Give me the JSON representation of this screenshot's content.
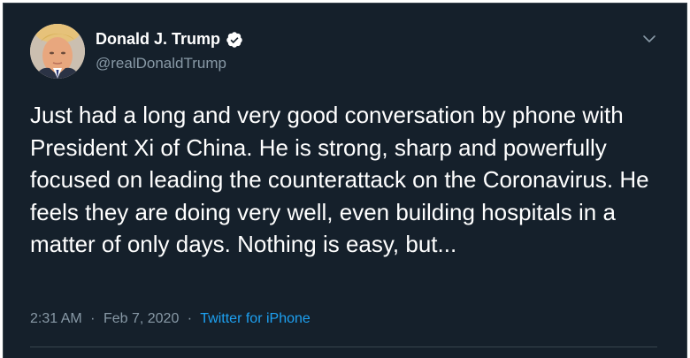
{
  "tweet": {
    "author": {
      "display_name": "Donald J. Trump",
      "handle": "@realDonaldTrump",
      "verified": true
    },
    "text": "Just had a long and very good conversation by phone with President Xi of China. He is strong, sharp and powerfully focused on leading the counterattack on the Coronavirus. He feels they are doing very well, even building hospitals in a matter of only days. Nothing is easy, but...",
    "time": "2:31 AM",
    "date": "Feb 7, 2020",
    "separator": "·",
    "source": "Twitter for iPhone"
  },
  "icons": {
    "verified": "verified-badge-icon",
    "more": "chevron-down-icon"
  },
  "colors": {
    "background": "#15202b",
    "text": "#ffffff",
    "secondary_text": "#8899a6",
    "link": "#1da1f2",
    "border": "#38444d"
  }
}
